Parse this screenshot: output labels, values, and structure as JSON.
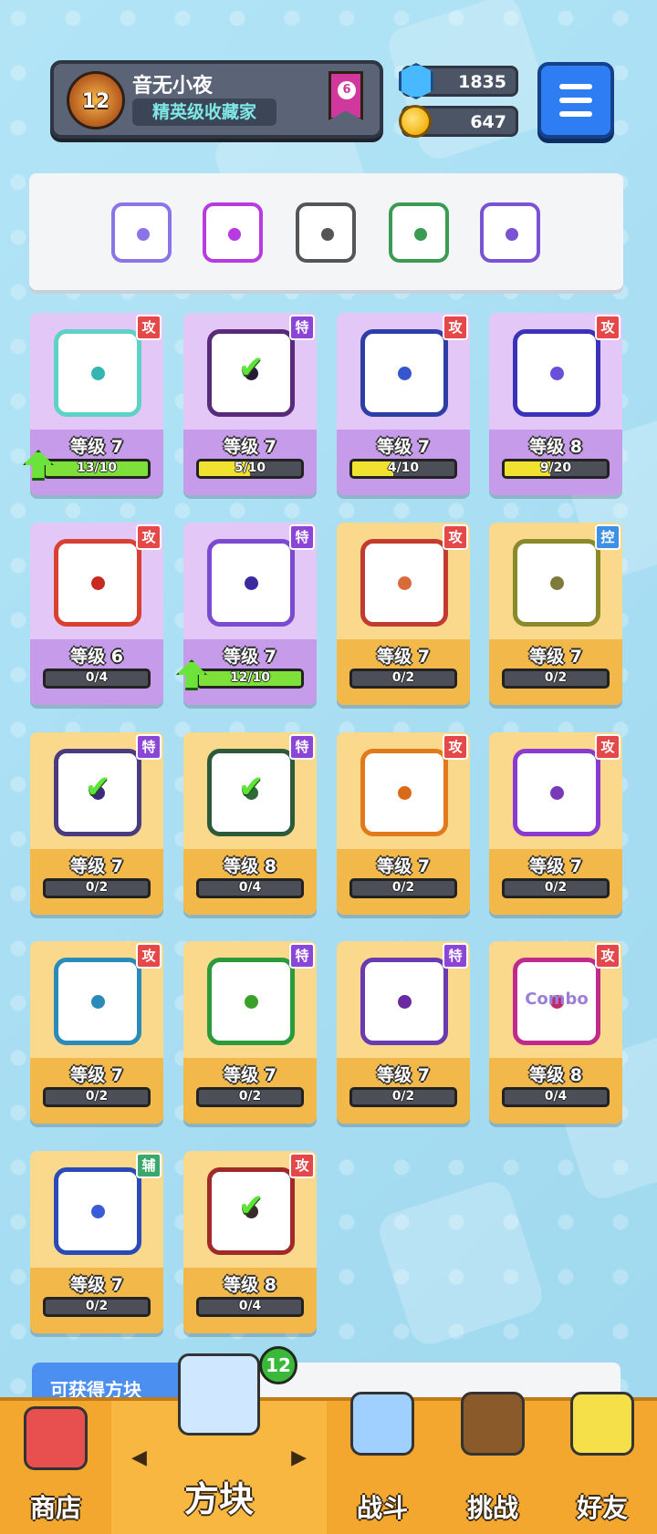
{
  "player": {
    "name": "音无小夜",
    "title": "精英级收藏家",
    "level": "12",
    "rank": "6"
  },
  "currency": {
    "gems": "1835",
    "coins": "647"
  },
  "deck": [
    {
      "name": "rainbow-die",
      "color": "#8b73e8"
    },
    {
      "name": "swap-die",
      "color": "#b83ae0"
    },
    {
      "name": "saw-die",
      "color": "#555555"
    },
    {
      "name": "star-die",
      "color": "#3b9b52"
    },
    {
      "name": "arrow-die",
      "color": "#7a52d4"
    }
  ],
  "tags": {
    "atk": "攻",
    "spc": "特",
    "ctl": "控",
    "sup": "辅"
  },
  "cards": [
    {
      "level": "等级 7",
      "progress": "13/10",
      "ratio": 1.0,
      "tag": "攻",
      "tagType": "atk",
      "style": "purple",
      "border": "#5fd2c7",
      "pip": "#35b5b2",
      "upgrade": true,
      "check": false,
      "fill": "green"
    },
    {
      "level": "等级 7",
      "progress": "5/10",
      "ratio": 0.5,
      "tag": "特",
      "tagType": "spc",
      "style": "purple",
      "border": "#5a2a7a",
      "pip": "#2a1a3a",
      "upgrade": false,
      "check": true,
      "fill": "yellow"
    },
    {
      "level": "等级 7",
      "progress": "4/10",
      "ratio": 0.4,
      "tag": "攻",
      "tagType": "atk",
      "style": "purple",
      "border": "#2d3fa6",
      "pip": "#3656d0",
      "upgrade": false,
      "check": false,
      "fill": "yellow"
    },
    {
      "level": "等级 8",
      "progress": "9/20",
      "ratio": 0.45,
      "tag": "攻",
      "tagType": "atk",
      "style": "purple",
      "border": "#3a32b8",
      "pip": "#6a4fd8",
      "upgrade": false,
      "check": false,
      "fill": "yellow"
    },
    {
      "level": "等级 6",
      "progress": "0/4",
      "ratio": 0,
      "tag": "攻",
      "tagType": "atk",
      "style": "purple",
      "border": "#d84032",
      "pip": "#c92a20",
      "upgrade": false,
      "check": false,
      "fill": "yellow"
    },
    {
      "level": "等级 7",
      "progress": "12/10",
      "ratio": 1.0,
      "tag": "特",
      "tagType": "spc",
      "style": "purple",
      "border": "#7a4ad0",
      "pip": "#3a2aa0",
      "upgrade": true,
      "check": false,
      "fill": "green"
    },
    {
      "level": "等级 7",
      "progress": "0/2",
      "ratio": 0,
      "tag": "攻",
      "tagType": "atk",
      "style": "gold",
      "border": "#c23a30",
      "pip": "#d96a3a",
      "upgrade": false,
      "check": false,
      "fill": "yellow"
    },
    {
      "level": "等级 7",
      "progress": "0/2",
      "ratio": 0,
      "tag": "控",
      "tagType": "ctl",
      "style": "gold",
      "border": "#8a8a2a",
      "pip": "#7d7a3a",
      "upgrade": false,
      "check": false,
      "fill": "yellow"
    },
    {
      "level": "等级 7",
      "progress": "0/2",
      "ratio": 0,
      "tag": "特",
      "tagType": "spc",
      "style": "gold",
      "border": "#4a3a80",
      "pip": "#3a2a80",
      "upgrade": false,
      "check": true,
      "fill": "yellow"
    },
    {
      "level": "等级 8",
      "progress": "0/4",
      "ratio": 0,
      "tag": "特",
      "tagType": "spc",
      "style": "gold",
      "border": "#2d5a3a",
      "pip": "#2d6a3a",
      "upgrade": false,
      "check": true,
      "fill": "yellow"
    },
    {
      "level": "等级 7",
      "progress": "0/2",
      "ratio": 0,
      "tag": "攻",
      "tagType": "atk",
      "style": "gold",
      "border": "#e07a1a",
      "pip": "#d86a1a",
      "upgrade": false,
      "check": false,
      "fill": "yellow"
    },
    {
      "level": "等级 7",
      "progress": "0/2",
      "ratio": 0,
      "tag": "攻",
      "tagType": "atk",
      "style": "gold",
      "border": "#8a3ad0",
      "pip": "#7a3ab8",
      "upgrade": false,
      "check": false,
      "fill": "yellow"
    },
    {
      "level": "等级 7",
      "progress": "0/2",
      "ratio": 0,
      "tag": "攻",
      "tagType": "atk",
      "style": "gold",
      "border": "#2a8ab8",
      "pip": "#2a8ab8",
      "upgrade": false,
      "check": false,
      "fill": "yellow"
    },
    {
      "level": "等级 7",
      "progress": "0/2",
      "ratio": 0,
      "tag": "特",
      "tagType": "spc",
      "style": "gold",
      "border": "#2a9a3a",
      "pip": "#3aa02a",
      "upgrade": false,
      "check": false,
      "fill": "yellow"
    },
    {
      "level": "等级 7",
      "progress": "0/2",
      "ratio": 0,
      "tag": "特",
      "tagType": "spc",
      "style": "gold",
      "border": "#6a3ab0",
      "pip": "#6a2aa0",
      "upgrade": false,
      "check": false,
      "fill": "yellow"
    },
    {
      "level": "等级 8",
      "progress": "0/4",
      "ratio": 0,
      "tag": "攻",
      "tagType": "atk",
      "style": "gold",
      "border": "#c02a8a",
      "pip": "#c02a6a",
      "upgrade": false,
      "check": false,
      "fill": "yellow",
      "logo": "Combo"
    },
    {
      "level": "等级 7",
      "progress": "0/2",
      "ratio": 0,
      "tag": "辅",
      "tagType": "sup",
      "style": "gold",
      "border": "#2a4ab8",
      "pip": "#3a5ad8",
      "upgrade": false,
      "check": false,
      "fill": "yellow"
    },
    {
      "level": "等级 8",
      "progress": "0/4",
      "ratio": 0,
      "tag": "攻",
      "tagType": "atk",
      "style": "gold",
      "border": "#a02a2a",
      "pip": "#3a2a2a",
      "upgrade": false,
      "check": true,
      "fill": "yellow"
    }
  ],
  "obtain_label": "可获得方块",
  "nav": {
    "badge": "12",
    "items": [
      {
        "label": "商店",
        "color": "#e85050"
      },
      {
        "label": "方块",
        "color": "#cfe8ff"
      },
      {
        "label": "战斗",
        "color": "#9fd0ff"
      },
      {
        "label": "挑战",
        "color": "#8a5a2a"
      },
      {
        "label": "好友",
        "color": "#f5e04a"
      }
    ]
  }
}
